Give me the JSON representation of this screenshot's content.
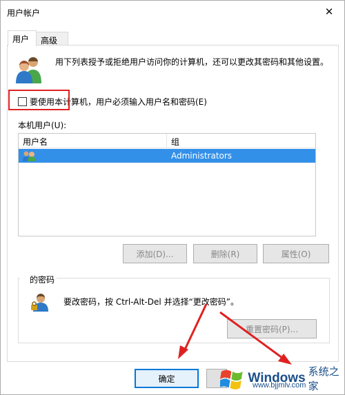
{
  "window": {
    "title": "用户帐户",
    "close_glyph": "✕"
  },
  "tabs": [
    {
      "label": "用户",
      "active": true
    },
    {
      "label": "高级",
      "active": false
    }
  ],
  "intro": {
    "text": "用下列表授予或拒绝用户访问你的计算机，还可以更改其密码和其他设置。",
    "icon": "users-icon"
  },
  "require_login": {
    "checked": false,
    "label": "要使用本计算机，用户必须输入用户名和密码(E)"
  },
  "user_list": {
    "label": "本机用户(U):",
    "columns": [
      "用户名",
      "组"
    ],
    "rows": [
      {
        "username": "",
        "group": "Administrators",
        "selected": true
      }
    ]
  },
  "buttons": {
    "add": "添加(D)...",
    "remove": "删除(R)",
    "properties": "属性(O)"
  },
  "password_group": {
    "title": "的密码",
    "text": "要改密码，按 Ctrl-Alt-Del 并选择“更改密码”。",
    "reset_button": "重置密码(P)...",
    "icon": "password-user-icon"
  },
  "dialog_buttons": {
    "ok": "确定"
  },
  "watermark": {
    "brand": "Windows",
    "cn": "系统之家",
    "url": "www.bjjmlv.com"
  },
  "colors": {
    "selection": "#3390e8",
    "highlight": "#e02020",
    "accent": "#0078d7"
  }
}
